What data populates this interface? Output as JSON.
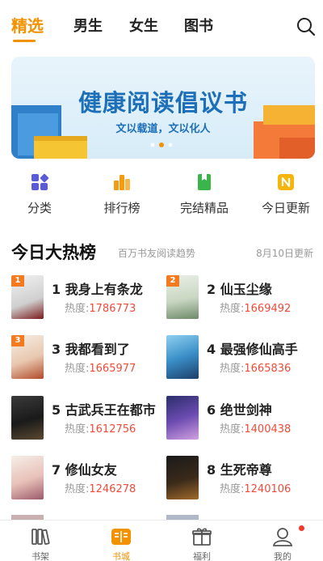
{
  "tabs": [
    {
      "label": "精选",
      "active": true
    },
    {
      "label": "男生",
      "active": false
    },
    {
      "label": "女生",
      "active": false
    },
    {
      "label": "图书",
      "active": false
    }
  ],
  "search": {
    "icon": "search-icon"
  },
  "banner": {
    "title": "健康阅读倡议书",
    "subtitle": "文以载道，文以化人",
    "page_count": 3,
    "active_page": 2
  },
  "categories": [
    {
      "label": "分类",
      "icon": "category-grid-icon",
      "color": "#5b5bd6"
    },
    {
      "label": "排行榜",
      "icon": "ranking-icon",
      "color": "#f39c12"
    },
    {
      "label": "完结精品",
      "icon": "finished-book-icon",
      "color": "#39b54a"
    },
    {
      "label": "今日更新",
      "icon": "update-n-icon",
      "color": "#f5b50a"
    }
  ],
  "section": {
    "title": "今日大热榜",
    "subtitle": "百万书友阅读趋势",
    "date": "8月10日更新"
  },
  "heat_label": "热度:",
  "books": [
    {
      "rank": "1",
      "title": "我身上有条龙",
      "heat": "1786773",
      "badge": true
    },
    {
      "rank": "2",
      "title": "仙玉尘缘",
      "heat": "1669492",
      "badge": true
    },
    {
      "rank": "3",
      "title": "我都看到了",
      "heat": "1665977",
      "badge": true
    },
    {
      "rank": "4",
      "title": "最强修仙高手",
      "heat": "1665836",
      "badge": false
    },
    {
      "rank": "5",
      "title": "古武兵王在都市",
      "heat": "1612756",
      "badge": false
    },
    {
      "rank": "6",
      "title": "绝世剑神",
      "heat": "1400438",
      "badge": false
    },
    {
      "rank": "7",
      "title": "修仙女友",
      "heat": "1246278",
      "badge": false
    },
    {
      "rank": "8",
      "title": "生死帝尊",
      "heat": "1240106",
      "badge": false
    }
  ],
  "bottom_nav": [
    {
      "label": "书架",
      "icon": "bookshelf-icon",
      "active": false
    },
    {
      "label": "书城",
      "icon": "bookstore-icon",
      "active": true
    },
    {
      "label": "福利",
      "icon": "gift-icon",
      "active": false
    },
    {
      "label": "我的",
      "icon": "profile-icon",
      "active": false,
      "notification": true
    }
  ],
  "colors": {
    "accent": "#f39200",
    "heat_value": "#f04a3a",
    "banner_text": "#1d6fb8"
  }
}
